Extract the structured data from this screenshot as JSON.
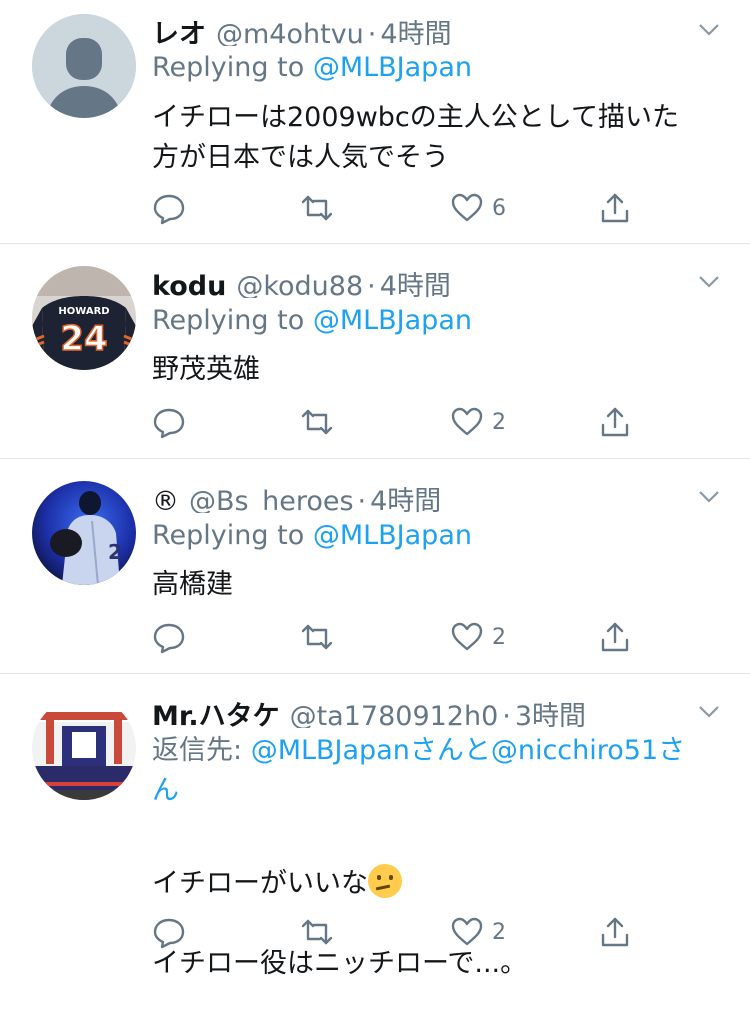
{
  "tweets": [
    {
      "name": "レオ",
      "handle": "@m4ohtvu",
      "time": "4時間",
      "reply_prefix": "Replying to ",
      "reply_mention": "@MLBJapan",
      "body": "イチローは2009wbcの主人公として描いた\n方が日本では人気でそう",
      "likes": "6"
    },
    {
      "name": "kodu",
      "handle": "@kodu88",
      "time": "4時間",
      "reply_prefix": "Replying to ",
      "reply_mention": "@MLBJapan",
      "body": "野茂英雄",
      "likes": "2",
      "avatar_text": {
        "jersey_name": "HOWARD",
        "jersey_number": "24"
      }
    },
    {
      "name": "®",
      "handle": "@Bs_heroes",
      "time": "4時間",
      "reply_prefix": "Replying to ",
      "reply_mention": "@MLBJapan",
      "body": "高橋建",
      "likes": "2"
    },
    {
      "name": "Mr.ハタケ",
      "handle": "@ta1780912h0",
      "time": "3時間",
      "reply_prefix": "返信先: ",
      "reply_mention": "@MLBJapanさんと@nicchiro51さ",
      "reply_mention_2": "ん",
      "body_line1": "イチローがいいな",
      "body_line2": "イチロー役はニッチローで...。",
      "likes": "2"
    }
  ],
  "separator": "·",
  "icons": [
    "reply-icon",
    "retweet-icon",
    "like-icon",
    "share-icon",
    "caret-down-icon",
    "thinking-face-emoji"
  ],
  "colors": {
    "text": "#14171a",
    "muted": "#657786",
    "link": "#1da1f2",
    "divider": "#e1e8ed"
  }
}
